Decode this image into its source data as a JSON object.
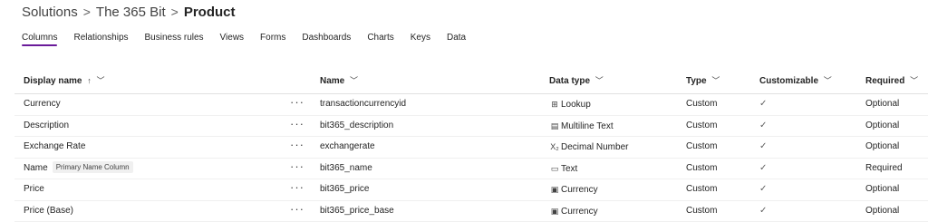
{
  "breadcrumb": {
    "items": [
      "Solutions",
      "The 365 Bit",
      "Product"
    ],
    "separator": ">"
  },
  "tabs": [
    "Columns",
    "Relationships",
    "Business rules",
    "Views",
    "Forms",
    "Dashboards",
    "Charts",
    "Keys",
    "Data"
  ],
  "active_tab": "Columns",
  "accent_color": "#6a1b9a",
  "table": {
    "headers": {
      "display_name": "Display name",
      "name": "Name",
      "data_type": "Data type",
      "type": "Type",
      "customizable": "Customizable",
      "required": "Required"
    },
    "sort_indicator": "↑",
    "more_label": "···",
    "check_mark": "✓",
    "rows": [
      {
        "display_name": "Currency",
        "badge": "",
        "name": "transactioncurrencyid",
        "data_type": "Lookup",
        "data_type_icon": "lookup-icon",
        "type": "Custom",
        "customizable": true,
        "required": "Optional"
      },
      {
        "display_name": "Description",
        "badge": "",
        "name": "bit365_description",
        "data_type": "Multiline Text",
        "data_type_icon": "multiline-text-icon",
        "type": "Custom",
        "customizable": true,
        "required": "Optional"
      },
      {
        "display_name": "Exchange Rate",
        "badge": "",
        "name": "exchangerate",
        "data_type": "Decimal Number",
        "data_type_icon": "decimal-number-icon",
        "type": "Custom",
        "customizable": true,
        "required": "Optional"
      },
      {
        "display_name": "Name",
        "badge": "Primary Name Column",
        "name": "bit365_name",
        "data_type": "Text",
        "data_type_icon": "text-icon",
        "type": "Custom",
        "customizable": true,
        "required": "Required"
      },
      {
        "display_name": "Price",
        "badge": "",
        "name": "bit365_price",
        "data_type": "Currency",
        "data_type_icon": "currency-icon",
        "type": "Custom",
        "customizable": true,
        "required": "Optional"
      },
      {
        "display_name": "Price (Base)",
        "badge": "",
        "name": "bit365_price_base",
        "data_type": "Currency",
        "data_type_icon": "currency-icon",
        "type": "Custom",
        "customizable": true,
        "required": "Optional"
      }
    ]
  }
}
